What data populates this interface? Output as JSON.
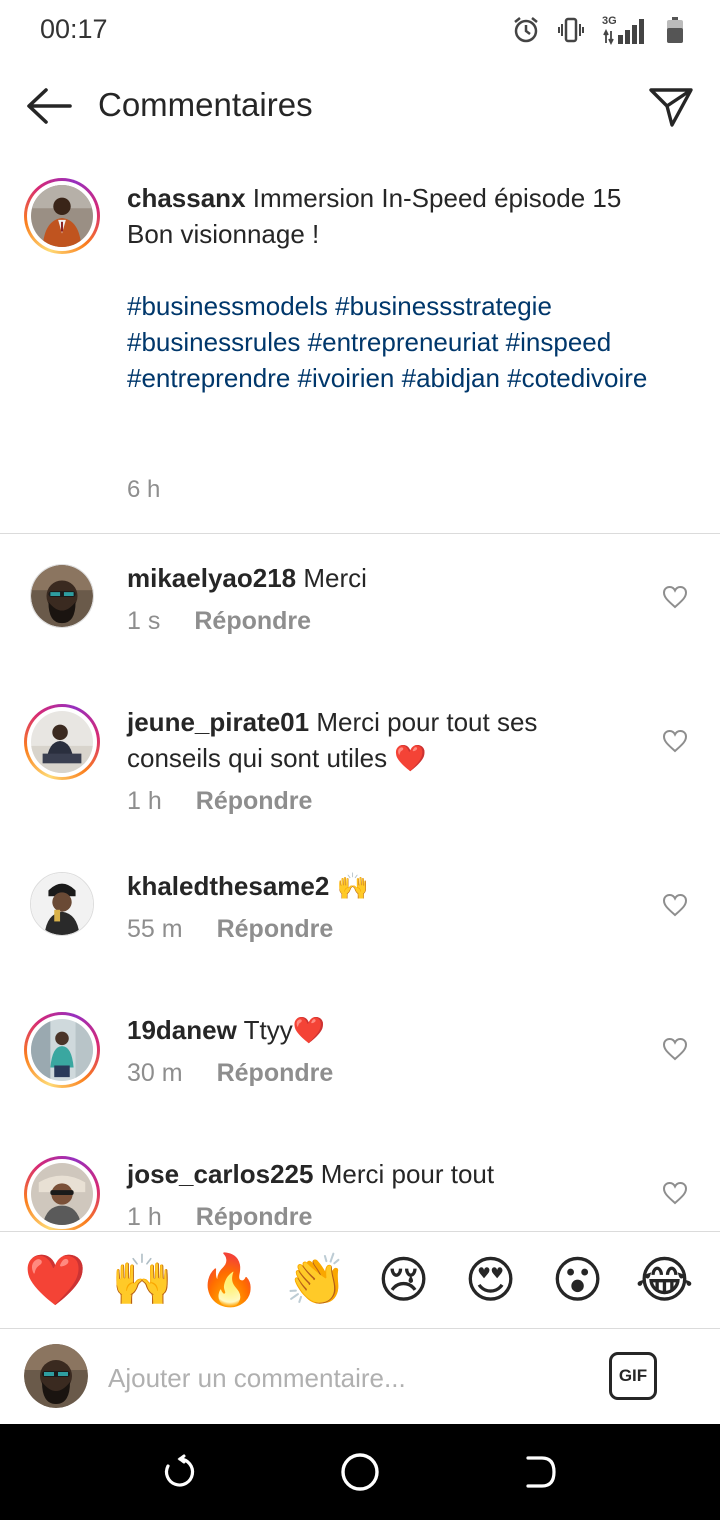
{
  "status_bar": {
    "time": "00:17",
    "network_label": "3G",
    "icons": [
      "alarm-icon",
      "vibrate-icon",
      "signal-icon",
      "battery-icon"
    ]
  },
  "header": {
    "title": "Commentaires",
    "back_icon": "back-arrow-icon",
    "send_icon": "direct-send-icon"
  },
  "caption": {
    "username": "chassanx",
    "line1": "Immersion In-Speed  épisode 15",
    "line2": "Bon visionnage !",
    "hashtags": "#businessmodels #businessstrategie #businessrules #entrepreneuriat #inspeed  #entreprendre #ivoirien #abidjan #cotedivoire",
    "time": "6 h"
  },
  "comments": [
    {
      "username": "mikaelyao218",
      "text": "Merci",
      "time": "1 s",
      "reply": "Répondre"
    },
    {
      "username": "jeune_pirate01",
      "text": "Merci pour tout ses conseils qui sont utiles ❤️",
      "time": "1 h",
      "reply": "Répondre"
    },
    {
      "username": "khaledthesame2",
      "text": "🙌",
      "time": "55 m",
      "reply": "Répondre"
    },
    {
      "username": "19danew",
      "text": "Ttyy❤️",
      "time": "30 m",
      "reply": "Répondre"
    },
    {
      "username": "jose_carlos225",
      "text": "Merci pour tout",
      "time": "1 h",
      "reply": "Répondre"
    }
  ],
  "emoji_bar": [
    "❤️",
    "🙌",
    "🔥",
    "👏",
    "😢",
    "😍",
    "😮",
    "😂"
  ],
  "composer": {
    "placeholder": "Ajouter un commentaire...",
    "gif_label": "GIF"
  },
  "colors": {
    "text": "#262626",
    "secondary": "#8e8e8e",
    "hashtag": "#00376b",
    "divider": "#dbdbdb",
    "nav_bar": "#000000"
  }
}
